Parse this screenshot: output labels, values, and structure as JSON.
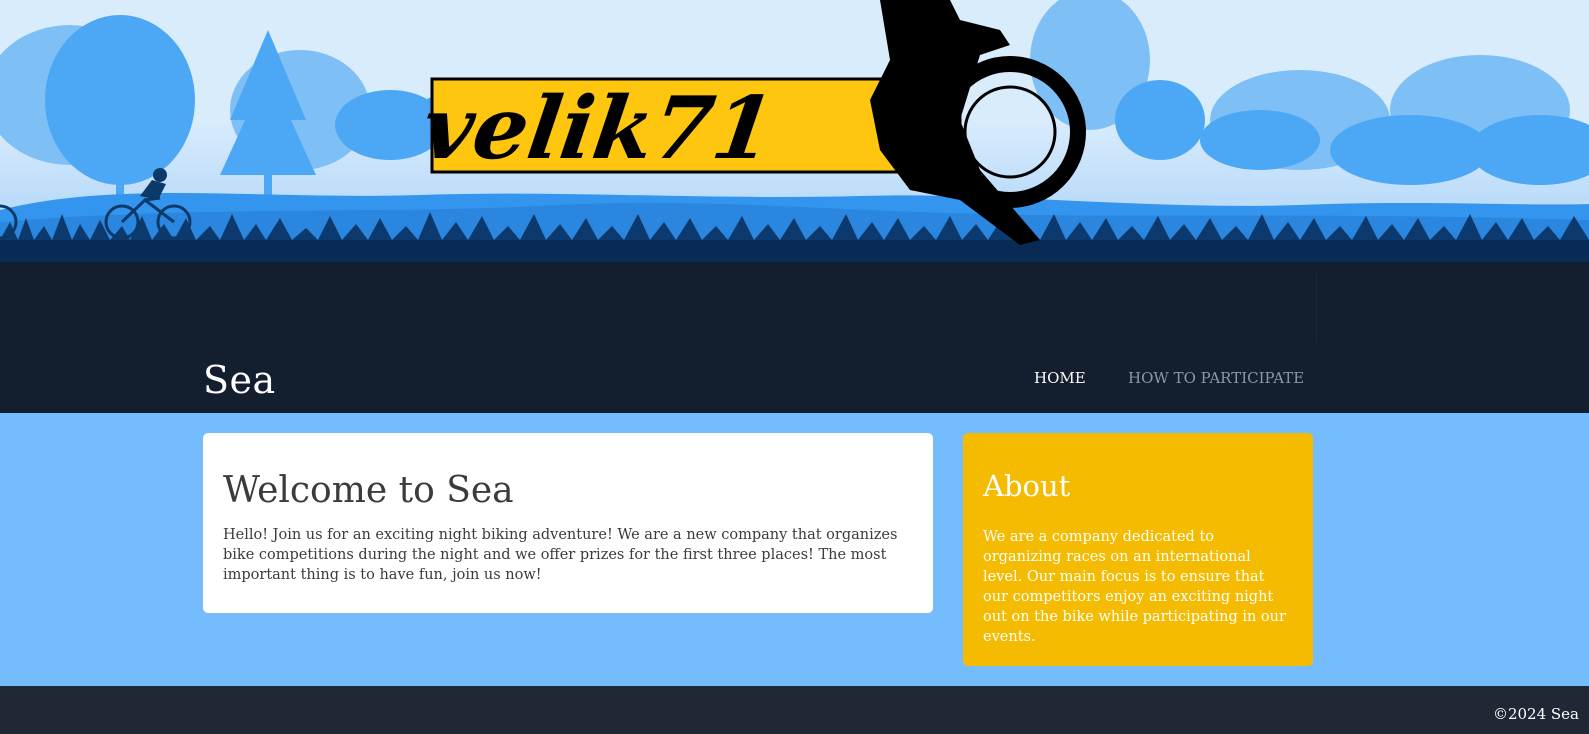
{
  "hero": {
    "logo_text": "velik71",
    "colors": {
      "sky": "#d9ecfc",
      "trees_far": "#4ca7f4",
      "trees_near": "#2a86de",
      "grass": "#082a55",
      "logo_bg": "#fec60f"
    }
  },
  "site": {
    "title": "Sea"
  },
  "nav": {
    "home": "HOME",
    "participate": "HOW TO PARTICIPATE"
  },
  "welcome": {
    "heading": "Welcome to Sea",
    "body": "Hello! Join us for an exciting night biking adventure! We are a new company that organizes bike competitions during the night and we offer prizes for the first three places! The most important thing is to have fun, join us now!"
  },
  "about": {
    "heading": "About",
    "body": "We are a company dedicated to organizing races on an international level. Our main focus is to ensure that our competitors enjoy an exciting night out on the bike while participating in our events."
  },
  "footer": {
    "copyright": "©2024 Sea"
  },
  "colors": {
    "page_bg": "#74bcfd",
    "header_bg": "#131f2e",
    "footer_bg": "#1e2935",
    "about_bg": "#f4bb00",
    "text_dark": "#3b3b3b",
    "nav_inactive": "#8d96a1"
  }
}
